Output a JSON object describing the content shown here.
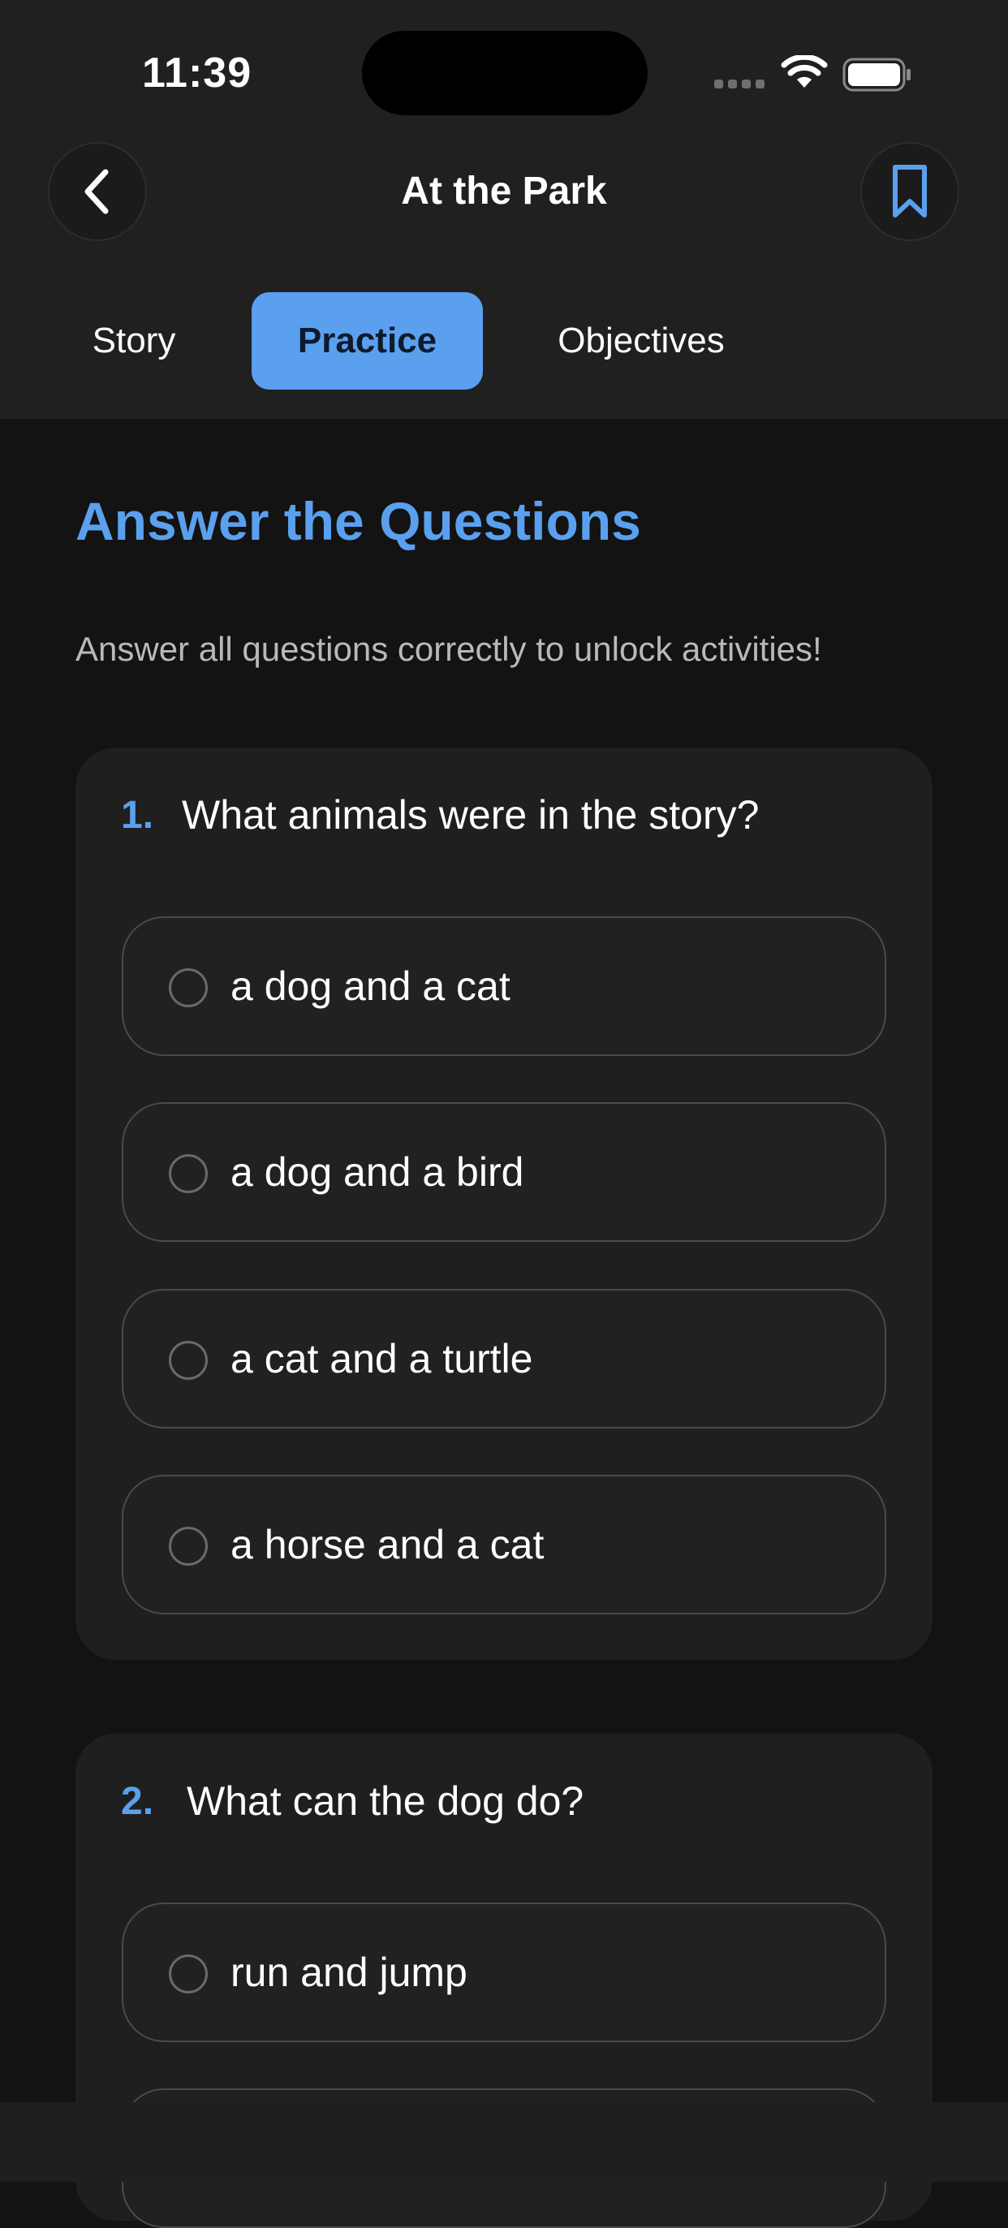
{
  "status_bar": {
    "time": "11:39"
  },
  "nav": {
    "title": "At the Park",
    "back_icon": "chevron-left-icon",
    "bookmark_icon": "bookmark-icon"
  },
  "tabs": [
    {
      "label": "Story",
      "active": false
    },
    {
      "label": "Practice",
      "active": true
    },
    {
      "label": "Objectives",
      "active": false
    }
  ],
  "main": {
    "title": "Answer the Questions",
    "subtitle": "Answer all questions correctly to unlock activities!",
    "questions": [
      {
        "number": "1.",
        "text": "What animals were in the story?",
        "options": [
          "a dog and a cat",
          "a dog and a bird",
          "a cat and a turtle",
          "a horse and a cat"
        ]
      },
      {
        "number": "2.",
        "text": "What can the dog do?",
        "options": [
          "run and jump",
          ""
        ]
      }
    ]
  },
  "colors": {
    "accent": "#5aa0ef",
    "background": "#131313",
    "header": "#202020",
    "card": "#1f1f1f"
  }
}
